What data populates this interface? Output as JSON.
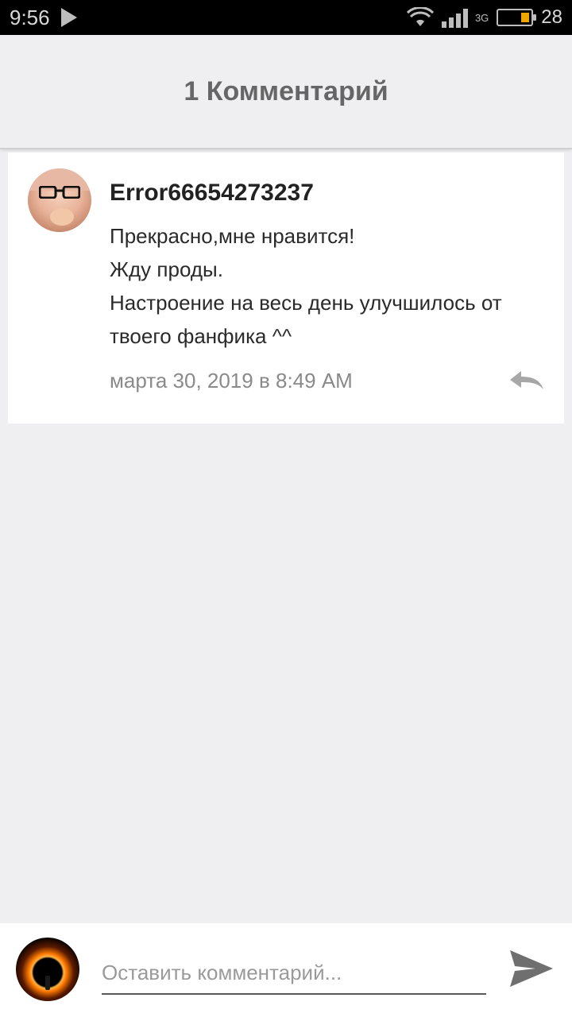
{
  "status_bar": {
    "time": "9:56",
    "battery_level": "28",
    "network": "3G",
    "icons": [
      "play-icon",
      "wifi-icon",
      "signal-icon",
      "battery-icon"
    ]
  },
  "header": {
    "title": "1 Комментарий"
  },
  "comments": [
    {
      "username": "Error66654273237",
      "lines": [
        "Прекрасно,мне нравится!",
        "Жду проды.",
        "Настроение на весь день улучшилось от",
        "твоего фанфика ^^"
      ],
      "date": "марта 30, 2019 в 8:49 AM"
    }
  ],
  "composer": {
    "placeholder": "Оставить комментарий...",
    "value": ""
  },
  "colors": {
    "background": "#efeef0",
    "header_text": "#666666",
    "battery_accent": "#f0a500"
  }
}
